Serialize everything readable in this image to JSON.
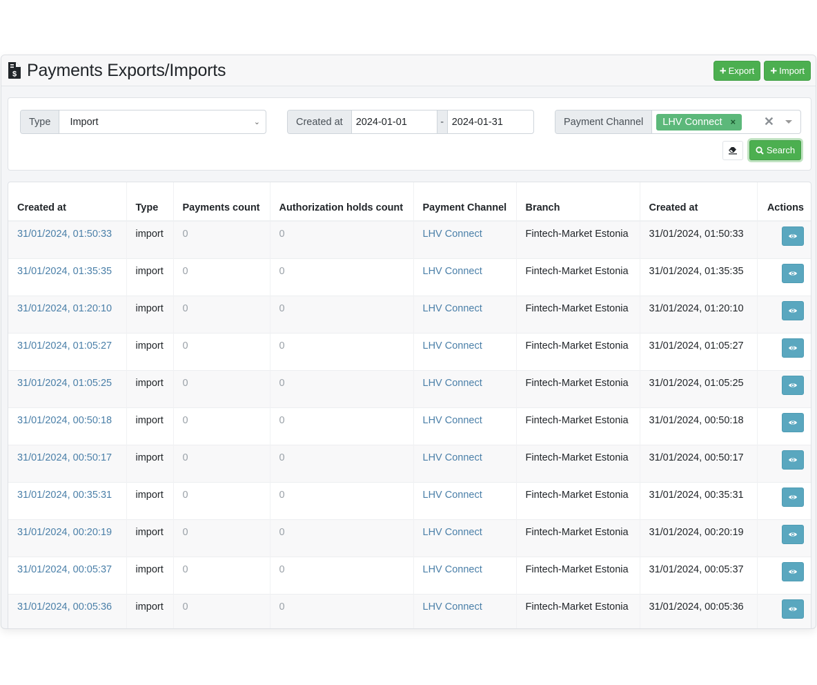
{
  "header": {
    "title": "Payments Exports/Imports",
    "title_icon": "file-invoice-dollar-icon",
    "export_label": "Export",
    "import_label": "Import"
  },
  "filters": {
    "type": {
      "label": "Type",
      "value": "Import"
    },
    "created_at": {
      "label": "Created at",
      "from": "2024-01-01",
      "separator": "-",
      "to": "2024-01-31"
    },
    "payment_channel": {
      "label": "Payment Channel",
      "selected_tags": [
        "LHV Connect"
      ],
      "tag_remove": "×",
      "clear": "✕"
    },
    "search_label": "Search"
  },
  "table": {
    "columns": [
      "Created at",
      "Type",
      "Payments count",
      "Authorization holds count",
      "Payment Channel",
      "Branch",
      "Created at",
      "Actions"
    ],
    "rows": [
      {
        "created_link": "31/01/2024, 01:50:33",
        "type": "import",
        "payments_count": "0",
        "holds_count": "0",
        "channel": "LHV Connect",
        "branch": "Fintech-Market Estonia",
        "created_at": "31/01/2024, 01:50:33"
      },
      {
        "created_link": "31/01/2024, 01:35:35",
        "type": "import",
        "payments_count": "0",
        "holds_count": "0",
        "channel": "LHV Connect",
        "branch": "Fintech-Market Estonia",
        "created_at": "31/01/2024, 01:35:35"
      },
      {
        "created_link": "31/01/2024, 01:20:10",
        "type": "import",
        "payments_count": "0",
        "holds_count": "0",
        "channel": "LHV Connect",
        "branch": "Fintech-Market Estonia",
        "created_at": "31/01/2024, 01:20:10"
      },
      {
        "created_link": "31/01/2024, 01:05:27",
        "type": "import",
        "payments_count": "0",
        "holds_count": "0",
        "channel": "LHV Connect",
        "branch": "Fintech-Market Estonia",
        "created_at": "31/01/2024, 01:05:27"
      },
      {
        "created_link": "31/01/2024, 01:05:25",
        "type": "import",
        "payments_count": "0",
        "holds_count": "0",
        "channel": "LHV Connect",
        "branch": "Fintech-Market Estonia",
        "created_at": "31/01/2024, 01:05:25"
      },
      {
        "created_link": "31/01/2024, 00:50:18",
        "type": "import",
        "payments_count": "0",
        "holds_count": "0",
        "channel": "LHV Connect",
        "branch": "Fintech-Market Estonia",
        "created_at": "31/01/2024, 00:50:18"
      },
      {
        "created_link": "31/01/2024, 00:50:17",
        "type": "import",
        "payments_count": "0",
        "holds_count": "0",
        "channel": "LHV Connect",
        "branch": "Fintech-Market Estonia",
        "created_at": "31/01/2024, 00:50:17"
      },
      {
        "created_link": "31/01/2024, 00:35:31",
        "type": "import",
        "payments_count": "0",
        "holds_count": "0",
        "channel": "LHV Connect",
        "branch": "Fintech-Market Estonia",
        "created_at": "31/01/2024, 00:35:31"
      },
      {
        "created_link": "31/01/2024, 00:20:19",
        "type": "import",
        "payments_count": "0",
        "holds_count": "0",
        "channel": "LHV Connect",
        "branch": "Fintech-Market Estonia",
        "created_at": "31/01/2024, 00:20:19"
      },
      {
        "created_link": "31/01/2024, 00:05:37",
        "type": "import",
        "payments_count": "0",
        "holds_count": "0",
        "channel": "LHV Connect",
        "branch": "Fintech-Market Estonia",
        "created_at": "31/01/2024, 00:05:37"
      },
      {
        "created_link": "31/01/2024, 00:05:36",
        "type": "import",
        "payments_count": "0",
        "holds_count": "0",
        "channel": "LHV Connect",
        "branch": "Fintech-Market Estonia",
        "created_at": "31/01/2024, 00:05:36"
      }
    ]
  }
}
